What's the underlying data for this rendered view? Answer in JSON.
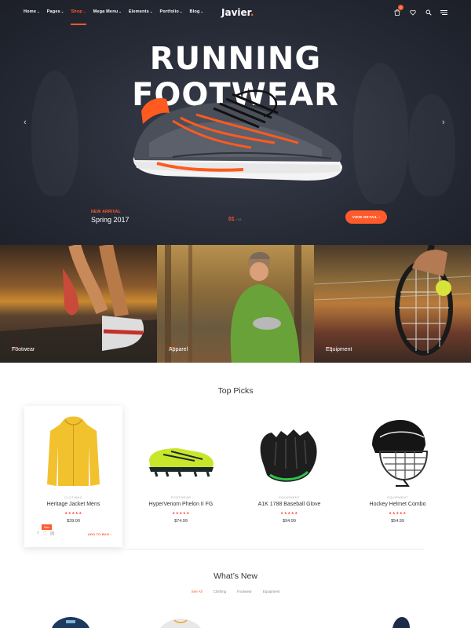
{
  "nav": {
    "menu": [
      {
        "label": "Home",
        "active": false
      },
      {
        "label": "Pages",
        "active": false
      },
      {
        "label": "Shop",
        "active": true
      },
      {
        "label": "Mega Menu",
        "active": false
      },
      {
        "label": "Elements",
        "active": false
      },
      {
        "label": "Portfolio",
        "active": false
      },
      {
        "label": "Blog",
        "active": false
      }
    ],
    "logo": "Javier",
    "cart_count": "0"
  },
  "hero": {
    "title_line1": "RUNNING",
    "title_line2": "FOOTWEAR",
    "tag": "NEW ARRIVAL",
    "season": "Spring 2017",
    "slide_current": "01",
    "slide_total": "/ 03",
    "cta": "VIEW DETAIL",
    "arrow_prev": "‹",
    "arrow_next": "›"
  },
  "categories": [
    {
      "label": "Footwear"
    },
    {
      "label": "Apparel"
    },
    {
      "label": "Equipment"
    }
  ],
  "top_picks": {
    "title": "Top Picks",
    "products": [
      {
        "category": "CLOTHING",
        "name": "Heritage Jacket Mens",
        "stars": "★★★★★",
        "price": "$39.00",
        "sale": "Sale",
        "add_to_bag": "ADD TO BAG"
      },
      {
        "category": "FOOTWEAR",
        "name": "HyperVenom Phelon II FG",
        "stars": "★★★★★",
        "price": "$74.99"
      },
      {
        "category": "EQUIPMENT",
        "name": "A1K 1788 Baseball Glove",
        "stars": "★★★★★",
        "price": "$94.99"
      },
      {
        "category": "EQUIPMENT",
        "name": "Hockey Helmet Combo",
        "stars": "★★★★★",
        "price": "$54.99"
      }
    ]
  },
  "whats_new": {
    "title": "What’s New",
    "filters": [
      {
        "label": "See All",
        "active": true
      },
      {
        "label": "Clothing",
        "active": false
      },
      {
        "label": "Footwear",
        "active": false
      },
      {
        "label": "Equipment",
        "active": false
      }
    ]
  },
  "colors": {
    "accent": "#ff5a2b",
    "hero_bg": "#272b36"
  }
}
